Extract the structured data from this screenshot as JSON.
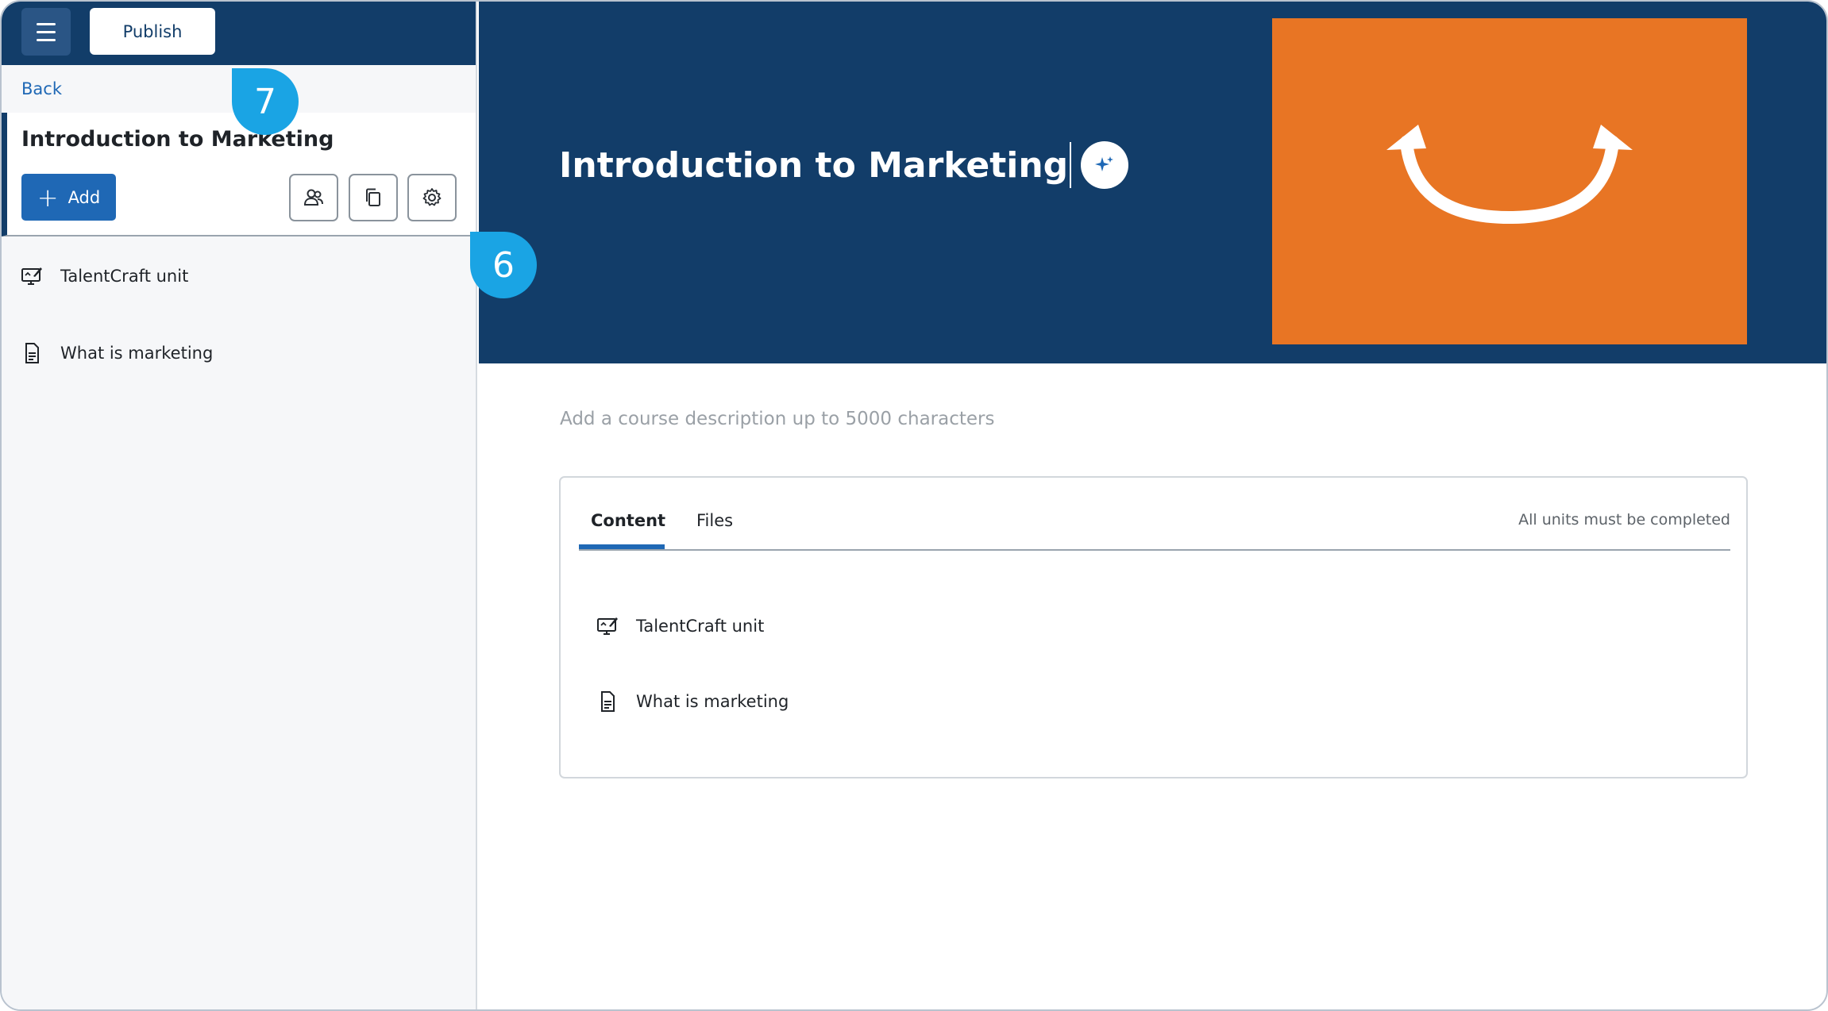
{
  "toolbar": {
    "menu_icon": "hamburger-menu-icon",
    "publish_label": "Publish"
  },
  "sidebar": {
    "back_label": "Back",
    "course_title": "Introduction to Marketing",
    "add_label": "Add",
    "tool_icons": [
      "users-icon",
      "copy-icon",
      "gear-icon"
    ],
    "items": [
      {
        "label": "TalentCraft unit",
        "icon": "monitor-edit-icon"
      },
      {
        "label": "What is marketing",
        "icon": "document-icon"
      }
    ]
  },
  "hero": {
    "title": "Introduction to Marketing",
    "ai_icon": "sparkle-icon",
    "cover_color": "#e87524"
  },
  "description_placeholder": "Add a course description up to 5000 characters",
  "content_card": {
    "tabs": [
      {
        "label": "Content",
        "active": true
      },
      {
        "label": "Files",
        "active": false
      }
    ],
    "completion_rule": "All units must be completed",
    "items": [
      {
        "label": "TalentCraft unit",
        "icon": "monitor-edit-icon"
      },
      {
        "label": "What is marketing",
        "icon": "document-icon"
      }
    ]
  },
  "callouts": [
    {
      "number": "7"
    },
    {
      "number": "6"
    }
  ],
  "colors": {
    "primary_navy": "#123d69",
    "accent_blue": "#1f68b5",
    "callout_blue": "#1aa4e4"
  }
}
